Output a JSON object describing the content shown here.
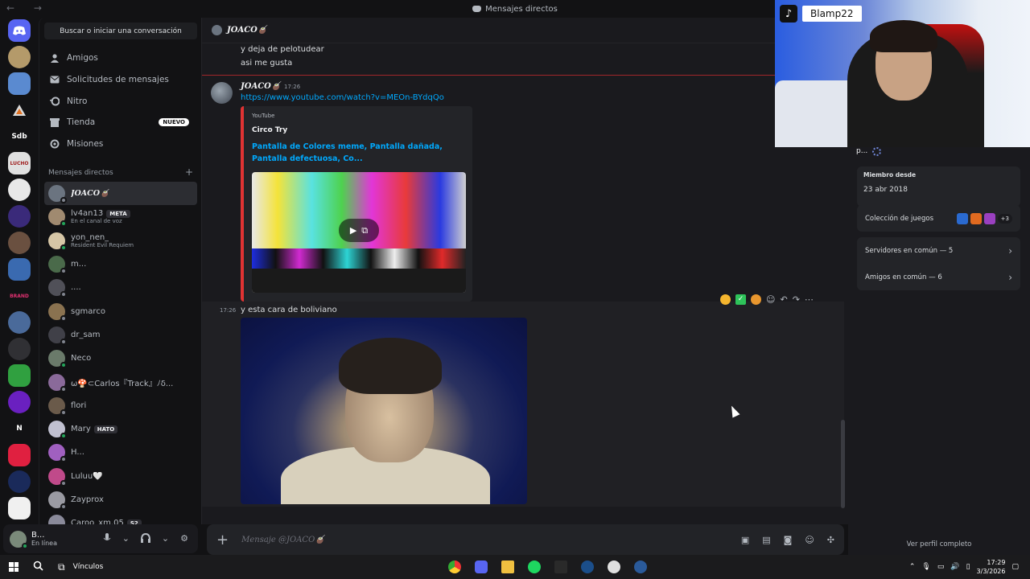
{
  "window": {
    "title": "Mensajes directos",
    "nav_arrows": "← →"
  },
  "servers": [
    {
      "icon": "discord-home-icon",
      "label": ""
    },
    {
      "icon": "server-icon",
      "label": ""
    },
    {
      "icon": "server-icon",
      "label": ""
    },
    {
      "icon": "server-icon",
      "label": ""
    },
    {
      "icon": "server-icon",
      "label": "Sdb"
    },
    {
      "icon": "server-icon",
      "label": ""
    }
  ],
  "sidebar": {
    "search_label": "Buscar o iniciar una conversación",
    "nav": [
      {
        "label": "Amigos",
        "icon": "friends-icon"
      },
      {
        "label": "Solicitudes de mensajes",
        "icon": "mail-icon"
      },
      {
        "label": "Nitro",
        "icon": "nitro-icon"
      },
      {
        "label": "Tienda",
        "icon": "shop-icon",
        "badge": "NUEVO"
      },
      {
        "label": "Misiones",
        "icon": "quests-icon"
      }
    ],
    "dm_header": "Mensajes directos",
    "dm_add": "+",
    "dms": [
      {
        "name": "JOACO🧉",
        "sub": "",
        "tag": "",
        "color": "#6b7480",
        "status": "off",
        "active": true,
        "italic": true
      },
      {
        "name": "lv4an13",
        "sub": "En el canal de voz",
        "tag": "META",
        "color": "#a08a70",
        "status": "on",
        "active": false,
        "italic": false
      },
      {
        "name": "yon_nen_",
        "sub": "Resident Evil Requiem",
        "tag": "",
        "color": "#d6c6a6",
        "status": "on",
        "active": false,
        "italic": false
      },
      {
        "name": "m...",
        "sub": "",
        "tag": "",
        "color": "#4a6a4a",
        "status": "off",
        "active": false,
        "italic": false
      },
      {
        "name": "....",
        "sub": "",
        "tag": "",
        "color": "#505058",
        "status": "off",
        "active": false,
        "italic": false
      },
      {
        "name": "sgmarco",
        "sub": "",
        "tag": "",
        "color": "#8a7250",
        "status": "off",
        "active": false,
        "italic": false
      },
      {
        "name": "dr_sam",
        "sub": "",
        "tag": "",
        "color": "#404048",
        "status": "off",
        "active": false,
        "italic": false
      },
      {
        "name": "Neco",
        "sub": "",
        "tag": "",
        "color": "#6a7a6a",
        "status": "on",
        "active": false,
        "italic": false
      },
      {
        "name": "ѡ🍄⊂Carlos『Track』ﾉδ...",
        "sub": "",
        "tag": "",
        "color": "#8a6a9a",
        "status": "off",
        "active": false,
        "italic": false
      },
      {
        "name": "flori",
        "sub": "",
        "tag": "",
        "color": "#6a5a4a",
        "status": "off",
        "active": false,
        "italic": false
      },
      {
        "name": "Mary",
        "sub": "",
        "tag": "HATO",
        "color": "#c0c0d0",
        "status": "on",
        "active": false,
        "italic": false
      },
      {
        "name": "H...",
        "sub": "",
        "tag": "",
        "color": "#a060c0",
        "status": "off",
        "active": false,
        "italic": false
      },
      {
        "name": "Luluu🤍",
        "sub": "",
        "tag": "",
        "color": "#c04a8a",
        "status": "off",
        "active": false,
        "italic": false
      },
      {
        "name": "Zayprox",
        "sub": "",
        "tag": "",
        "color": "#9a9aa2",
        "status": "off",
        "active": false,
        "italic": false
      },
      {
        "name": "Caroo_xm.05",
        "sub": "",
        "tag": "S2",
        "color": "#8a8a9a",
        "status": "off",
        "active": false,
        "italic": false
      }
    ]
  },
  "user": {
    "name": "B...",
    "status": "En línea"
  },
  "chat": {
    "header_name": "JOACO🧉",
    "prev_lines": [
      "y deja de pelotudear",
      "asi me gusta"
    ],
    "author": "JOACO🧉",
    "time": "17:26",
    "link": "https://www.youtube.com/watch?v=MEOn-BYdqQo",
    "embed": {
      "provider": "YouTube",
      "author": "Circo Try",
      "title": "Pantalla de Colores meme, Pantalla dañada, Pantalla defectuosa, Co..."
    },
    "second_time": "17:26",
    "second_text": "y esta cara de boliviano",
    "composer_placeholder": "Mensaje @JOACO🧉"
  },
  "profile": {
    "name_short": "p...",
    "member_since_label": "Miembro desde",
    "member_since": "23 abr 2018",
    "games_label": "Colección de juegos",
    "games_more": "+3",
    "servers_label": "Servidores en común — 5",
    "friends_label": "Amigos en común — 6",
    "view_full": "Ver perfil completo"
  },
  "overlay": {
    "tiktok_handle": "Blamp22"
  },
  "taskbar": {
    "links_label": "Vínculos",
    "time": "17:29",
    "date": "3/3/2026"
  }
}
